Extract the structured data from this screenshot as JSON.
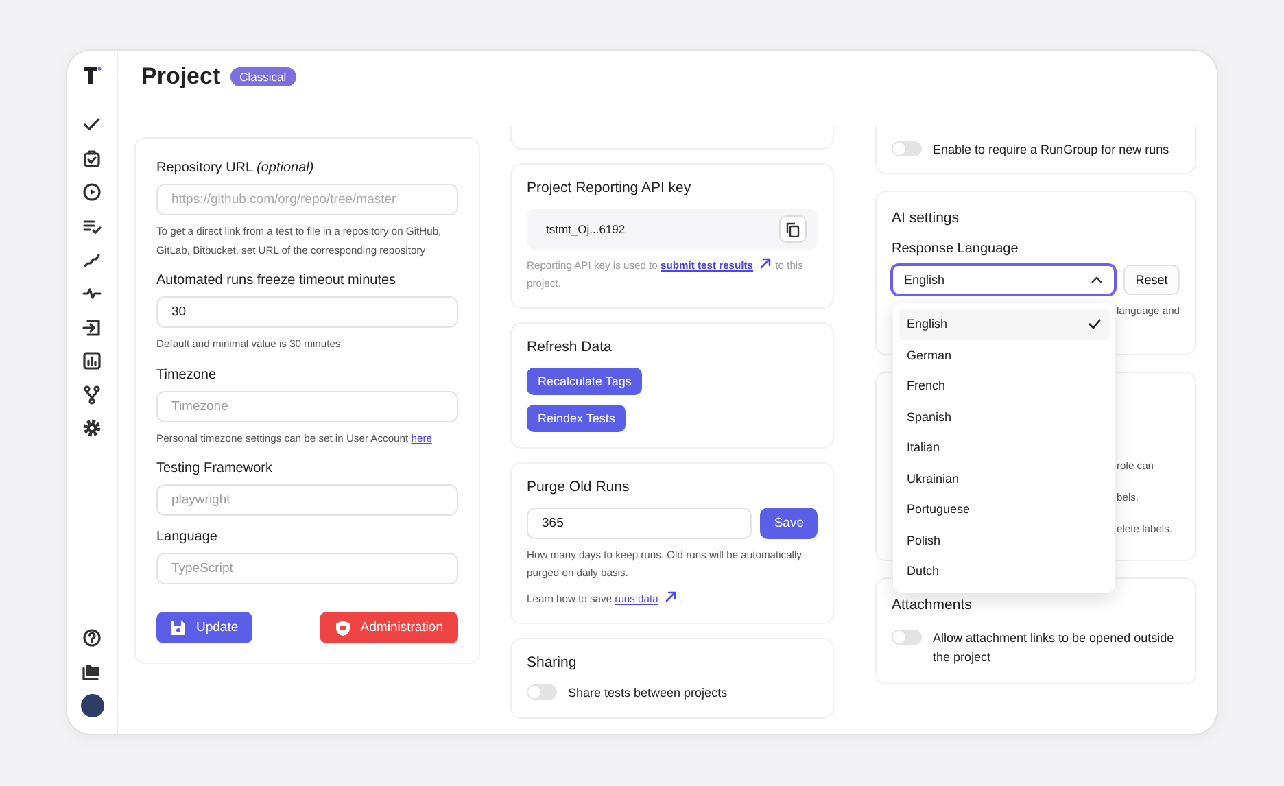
{
  "header": {
    "title": "Project",
    "badge": "Classical"
  },
  "general": {
    "fields": [
      {
        "label": "Repository URL *(optional)*",
        "placeholder": "https://github.com/org/repo/tree/master",
        "hint": "To get a direct link from a test to file in a repository on GitHub, GitLab, Bitbucket, set URL of the corresponding repository"
      },
      {
        "label": "Automated runs freeze timeout minutes",
        "value": "30",
        "hint": "Default and minimal value is 30 minutes"
      },
      {
        "label": "Timezone",
        "placeholder": "Timezone",
        "hint": "Personal timezone settings can be set in User Account",
        "hint_link": "here"
      },
      {
        "label": "Testing Framework",
        "placeholder": "playwright"
      },
      {
        "label": "Language",
        "placeholder": "TypeScript"
      }
    ],
    "buttons": [
      {
        "label": "Update",
        "kind": "primary"
      },
      {
        "label": "Administration",
        "kind": "danger"
      }
    ]
  },
  "api_key": {
    "title": "Project Reporting API key",
    "key": "tstmt_Oj...6192",
    "hint": "Reporting API key is used to",
    "hint_link": "submit test results",
    "hint_end": "to this project."
  },
  "refresh": {
    "title": "Refresh Data",
    "buttons": [
      "Recalculate Tags",
      "Reindex Tests"
    ]
  },
  "purge": {
    "title": "Purge Old Runs",
    "value": "365",
    "button": "Save",
    "hint": "How many days to keep runs. Old runs will be automatically purged on daily basis.",
    "learn": "Learn how to save",
    "learn_link": "runs data",
    "learn_end": "."
  },
  "sharing": {
    "title": "Sharing",
    "toggle": {
      "label": "Share tests between projects",
      "on": false
    }
  },
  "rungroup": {
    "toggle": {
      "label": "Enable to require a RunGroup for new runs",
      "on": false
    }
  },
  "ai": {
    "title": "AI settings",
    "label": "Response Language",
    "value": "English",
    "expanded": true,
    "reset": "Reset",
    "hint": "language and",
    "options": [
      {
        "label": "English",
        "selected": true
      },
      {
        "label": "German",
        "selected": false
      },
      {
        "label": "French",
        "selected": false
      },
      {
        "label": "Spanish",
        "selected": false
      },
      {
        "label": "Italian",
        "selected": false
      },
      {
        "label": "Ukrainian",
        "selected": false
      },
      {
        "label": "Portuguese",
        "selected": false
      },
      {
        "label": "Polish",
        "selected": false
      },
      {
        "label": "Dutch",
        "selected": false
      }
    ]
  },
  "covered_card": {
    "texts": [
      "role can",
      "bels.",
      "elete labels."
    ]
  },
  "attachments": {
    "title": "Attachments",
    "toggle": {
      "label": "Allow attachment links to be opened outside the project",
      "on": false
    }
  }
}
